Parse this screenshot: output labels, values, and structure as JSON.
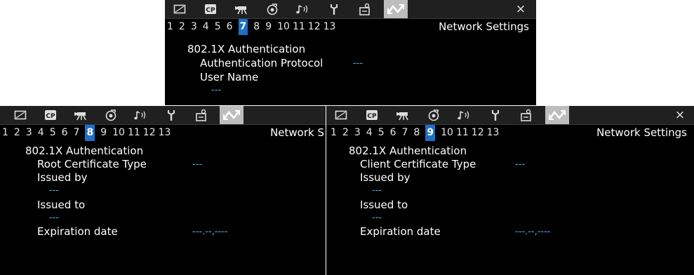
{
  "tab_icons": [
    "frame-icon",
    "cp-icon",
    "camera-icon",
    "settings-dial-icon",
    "audio-icon",
    "wrench-icon",
    "assign-icon",
    "network-icon"
  ],
  "close_glyph": "×",
  "colors": {
    "accent": "#1e6fc5",
    "value": "#4bb7e6",
    "tab_active": "#bdbdbd"
  },
  "page_numbers": [
    "1",
    "2",
    "3",
    "4",
    "5",
    "6",
    "7",
    "8",
    "9",
    "10",
    "11",
    "12",
    "13"
  ],
  "screens": {
    "top": {
      "selected_page": "7",
      "title": "Network Settings",
      "heading": "802.1X Authentication",
      "protocol_label": "Authentication Protocol",
      "protocol_value": "---",
      "username_label": "User Name",
      "username_value": "---"
    },
    "left": {
      "selected_page": "8",
      "title": "Network S",
      "heading": "802.1X Authentication",
      "cert_type_label": "Root Certificate Type",
      "cert_type_value": "---",
      "issued_by_label": "Issued by",
      "issued_by_value": "---",
      "issued_to_label": "Issued to",
      "issued_to_value": "---",
      "expiration_label": "Expiration date",
      "expiration_value": "---.--,----"
    },
    "right": {
      "selected_page": "9",
      "title": "Network Settings",
      "heading": "802.1X Authentication",
      "cert_type_label": "Client Certificate Type",
      "cert_type_value": "---",
      "issued_by_label": "Issued by",
      "issued_by_value": "---",
      "issued_to_label": "Issued to",
      "issued_to_value": "---",
      "expiration_label": "Expiration date",
      "expiration_value": "---.--,----"
    }
  }
}
